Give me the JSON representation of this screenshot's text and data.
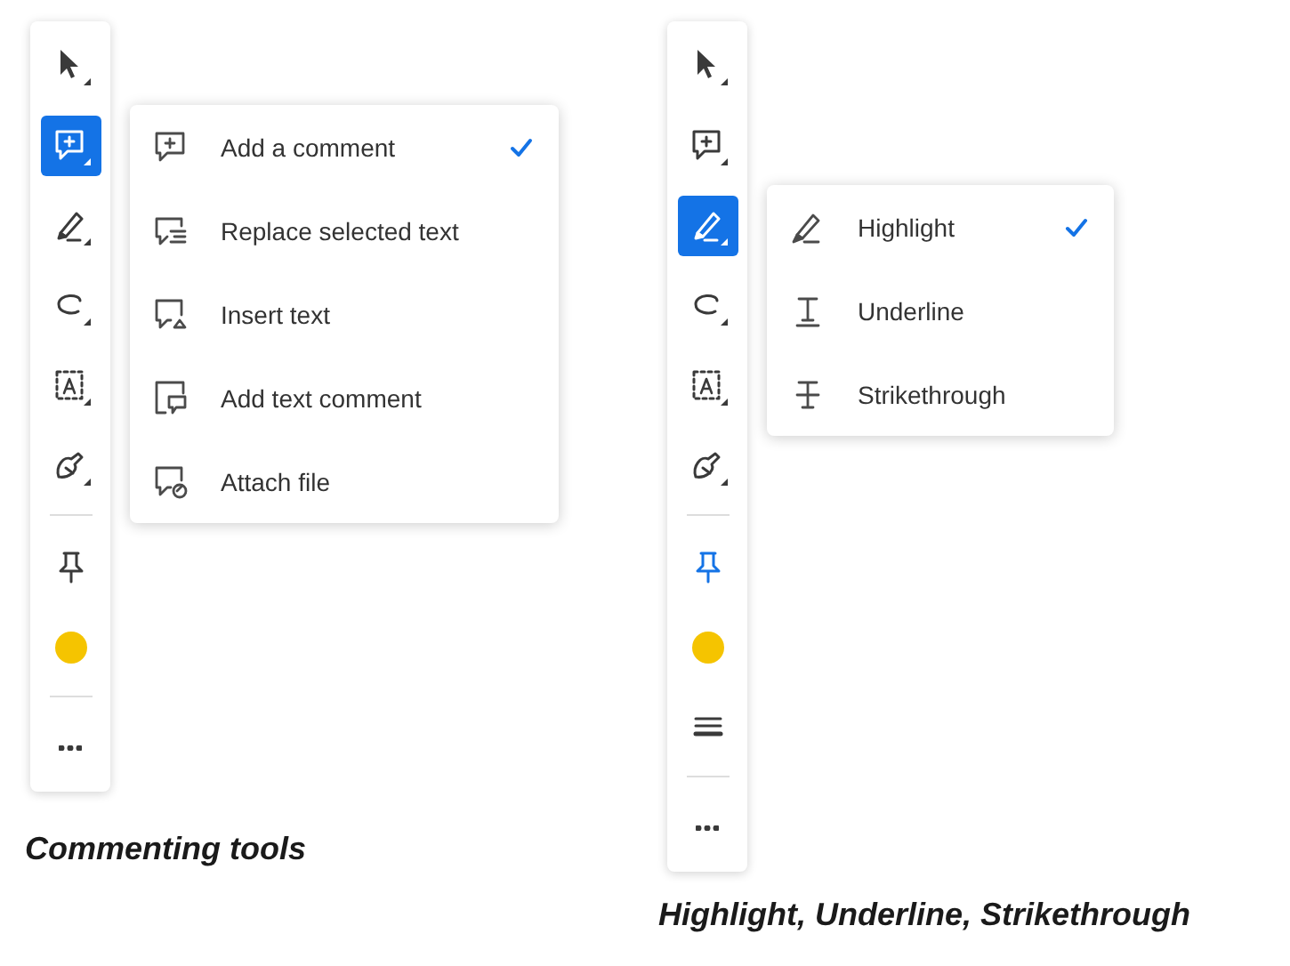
{
  "panels": [
    {
      "toolbar": [
        {
          "kind": "select",
          "selected": false
        },
        {
          "kind": "comment",
          "selected": true
        },
        {
          "kind": "highlight",
          "selected": false
        },
        {
          "kind": "draw",
          "selected": false
        },
        {
          "kind": "textbox",
          "selected": false
        },
        {
          "kind": "sign",
          "selected": false
        },
        {
          "kind": "divider"
        },
        {
          "kind": "pin",
          "active": false
        },
        {
          "kind": "color",
          "color": "#f5c400"
        },
        {
          "kind": "divider"
        },
        {
          "kind": "more"
        }
      ],
      "menu": [
        {
          "kind": "add-comment",
          "label": "Add a comment",
          "selected": true
        },
        {
          "kind": "replace-text",
          "label": "Replace selected text",
          "selected": false
        },
        {
          "kind": "insert-text",
          "label": "Insert text",
          "selected": false
        },
        {
          "kind": "text-comment",
          "label": "Add text comment",
          "selected": false
        },
        {
          "kind": "attach",
          "label": "Attach file",
          "selected": false
        }
      ],
      "caption": "Commenting tools"
    },
    {
      "toolbar": [
        {
          "kind": "select",
          "selected": false
        },
        {
          "kind": "comment",
          "selected": false
        },
        {
          "kind": "highlight",
          "selected": true
        },
        {
          "kind": "draw",
          "selected": false
        },
        {
          "kind": "textbox",
          "selected": false
        },
        {
          "kind": "sign",
          "selected": false
        },
        {
          "kind": "divider"
        },
        {
          "kind": "pin",
          "active": true
        },
        {
          "kind": "color",
          "color": "#f5c400"
        },
        {
          "kind": "lines"
        },
        {
          "kind": "divider"
        },
        {
          "kind": "more"
        }
      ],
      "menu": [
        {
          "kind": "highlight",
          "label": "Highlight",
          "selected": true
        },
        {
          "kind": "underline",
          "label": "Underline",
          "selected": false
        },
        {
          "kind": "strikethrough",
          "label": "Strikethrough",
          "selected": false
        }
      ],
      "caption": "Highlight, Underline, Strikethrough"
    }
  ]
}
